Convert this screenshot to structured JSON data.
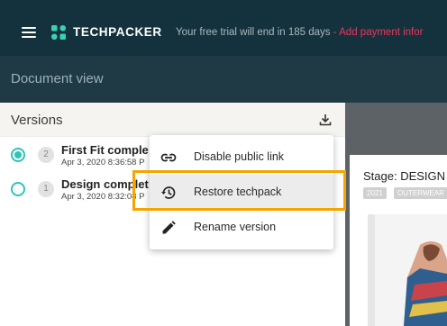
{
  "topbar": {
    "logo_text": "TECHPACKER",
    "trial_text": "Your free trial will end in 185 days",
    "trial_separator": " - ",
    "payment_link": "Add payment infor"
  },
  "page": {
    "title": "Document view"
  },
  "versions": {
    "title": "Versions",
    "items": [
      {
        "number": "2",
        "name": "First Fit comple",
        "date": "Apr 3, 2020 8:36:58 P",
        "selected": true
      },
      {
        "number": "1",
        "name": "Design complet",
        "date": "Apr 3, 2020 8:32:08 P",
        "selected": false
      }
    ]
  },
  "context_menu": {
    "items": [
      {
        "label": "Disable public link",
        "icon": "link-icon"
      },
      {
        "label": "Restore techpack",
        "icon": "history-icon"
      },
      {
        "label": "Rename version",
        "icon": "pencil-icon"
      }
    ]
  },
  "preview": {
    "stage": "Stage: DESIGN",
    "tags": [
      "2021",
      "OUTERWEAR"
    ]
  },
  "colors": {
    "topbar": "#14323d",
    "subbar": "#1f3a45",
    "accent_teal": "#2ec4b6",
    "payment_pink": "#f0345e",
    "highlight_orange": "#f5a400"
  }
}
